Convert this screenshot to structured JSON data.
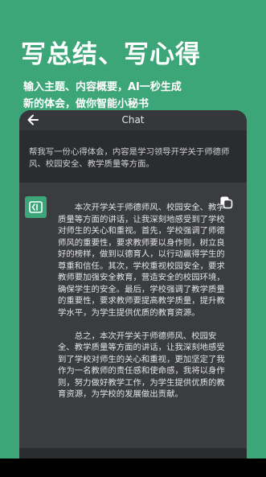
{
  "promo": {
    "headline": "写总结、写心得",
    "subline_1": "输入主题、内容概要，AI一秒生成",
    "subline_2": "新的体会，做你智能小秘书"
  },
  "chat": {
    "title": "Chat",
    "prompt": "帮我写一份心得体会，内容是学习领导开学关于师德师风、校园安全、教学质量等方面。",
    "answer_paragraphs": [
      "本次开学关于师德师风、校园安全、教学质量等方面的讲话，让我深刻地感受到了学校对师生的关心和重视。首先，学校强调了师德师风的重要性，要求教师要以身作则，树立良好的榜样，做到以德育人，以行动赢得学生的尊重和信任。其次，学校重视校园安全，要求教师要加强安全教育，营造安全的校园环境，确保学生的安全。最后，学校强调了教学质量的重要性，要求教师要提高教学质量，提升教学水平，为学生提供优质的教育资源。",
      "总之，本次开学关于师德师风、校园安全、教学质量等方面的讲话，让我深刻地感受到了学校对师生的关心和重视，更加坚定了我作为一名教师的责任感和使命感，我将以身作则，努力做好教学工作，为学生提供优质的教育资源，为学校的发展做出贡献。"
    ]
  },
  "icons": {
    "back": "back-arrow-icon",
    "avatar": "ai-avatar-icon",
    "copy": "copy-icon"
  },
  "colors": {
    "background": "#3da678",
    "card": "#2a2c30",
    "answer_card": "#3a3c40",
    "accent": "#3da678"
  }
}
